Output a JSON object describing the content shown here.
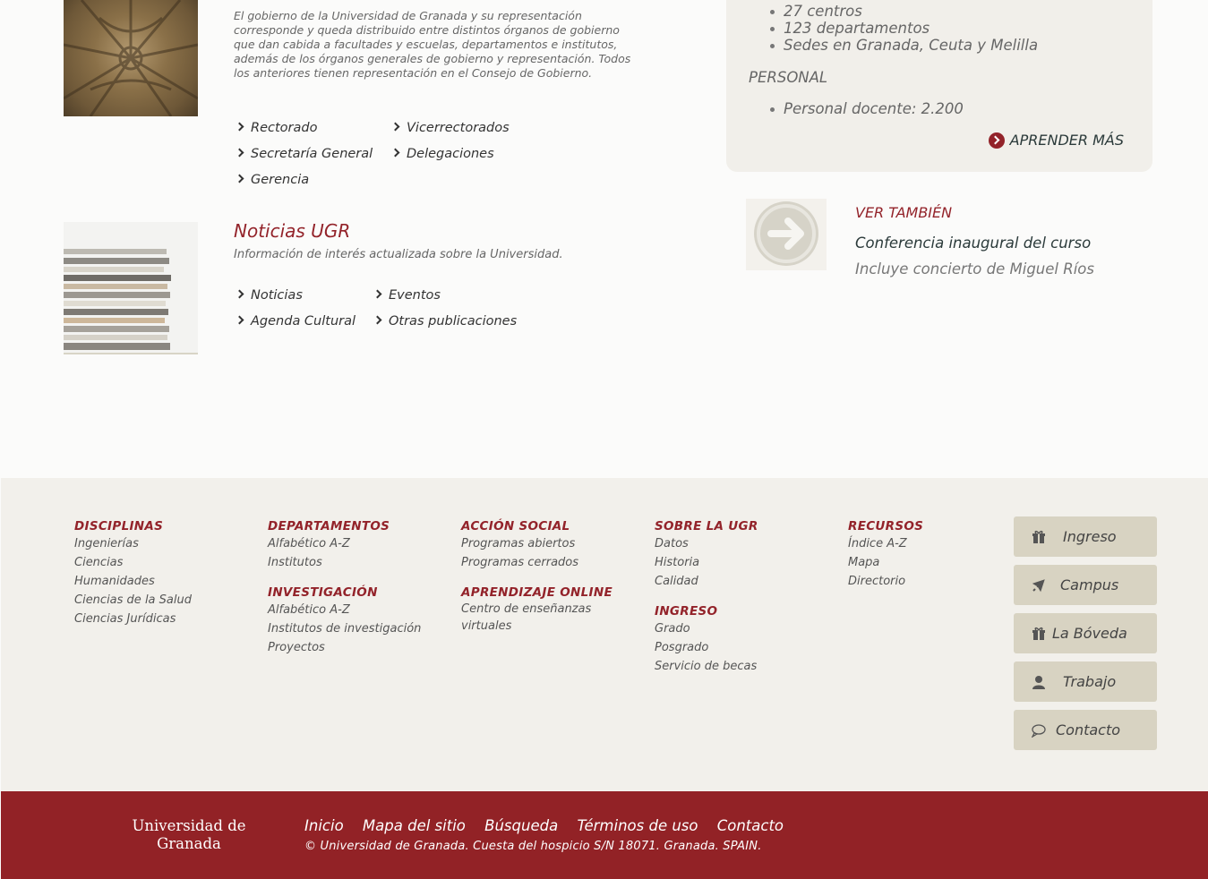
{
  "gobierno": {
    "description": "El gobierno de la Universidad de Granada y su representación corresponde y queda distribuido entre distintos órganos de gobierno que dan cabida a facultades y escuelas, departamentos e institutos, además de los órganos generales de gobierno y representación. Todos los anteriores tienen representación en el Consejo de Gobierno.",
    "links": [
      "Rectorado",
      "Vicerrectorados",
      "Secretaría General",
      "Delegaciones",
      "Gerencia"
    ]
  },
  "noticias": {
    "title": "Noticias UGR",
    "description": "Información de interés actualizada sobre la Universidad.",
    "links": [
      "Noticias",
      "Eventos",
      "Agenda Cultural",
      "Otras publicaciones"
    ]
  },
  "infobox": {
    "items": [
      "27 centros",
      "123 departamentos",
      "Sedes en Granada, Ceuta y Melilla"
    ],
    "personal_heading": "PERSONAL",
    "personal_items": [
      "Personal docente: 2.200"
    ],
    "learn_more": "APRENDER MÁS"
  },
  "see_also": {
    "title": "VER TAMBIÉN",
    "link": "Conferencia inaugural del curso",
    "subtitle": "Incluye concierto de Miguel Ríos"
  },
  "footer": {
    "columns": [
      {
        "sections": [
          {
            "heading": "DISCIPLINAS",
            "links": [
              "Ingenierías",
              "Ciencias",
              "Humanidades",
              "Ciencias de la Salud",
              "Ciencias Jurídicas"
            ]
          }
        ]
      },
      {
        "sections": [
          {
            "heading": "DEPARTAMENTOS",
            "links": [
              "Alfabético A-Z",
              "Institutos"
            ]
          },
          {
            "heading": "INVESTIGACIÓN",
            "links": [
              "Alfabético A-Z",
              "Institutos de investigación",
              "Proyectos"
            ]
          }
        ]
      },
      {
        "sections": [
          {
            "heading": "ACCIÓN SOCIAL",
            "links": [
              "Programas abiertos",
              "Programas cerrados"
            ]
          },
          {
            "heading": "APRENDIZAJE ONLINE",
            "links": [
              "Centro de enseñanzas virtuales"
            ]
          }
        ]
      },
      {
        "sections": [
          {
            "heading": "SOBRE LA UGR",
            "links": [
              "Datos",
              "Historia",
              "Calidad"
            ]
          },
          {
            "heading": "INGRESO",
            "links": [
              "Grado",
              "Posgrado",
              "Servicio de becas"
            ]
          }
        ]
      },
      {
        "sections": [
          {
            "heading": "RECURSOS",
            "links": [
              "Índice A-Z",
              "Mapa",
              "Directorio"
            ]
          }
        ]
      }
    ],
    "buttons": [
      {
        "label": "Ingreso",
        "icon": "gift-icon"
      },
      {
        "label": "Campus",
        "icon": "plane-icon"
      },
      {
        "label": "La Bóveda",
        "icon": "gift-icon"
      },
      {
        "label": "Trabajo",
        "icon": "user-icon"
      },
      {
        "label": "Contacto",
        "icon": "chat-icon"
      }
    ]
  },
  "bottom": {
    "logo_line1": "Universidad de",
    "logo_line2": "Granada",
    "nav": [
      "Inicio",
      "Mapa del sitio",
      "Búsqueda",
      "Términos de uso",
      "Contacto"
    ],
    "copyright": "© Universidad de Granada. Cuesta del hospicio S/N 18071. Granada. SPAIN."
  },
  "colors": {
    "accent": "#922226",
    "footer_bg": "#f2f0eb",
    "button_bg": "#d8d3c2"
  }
}
